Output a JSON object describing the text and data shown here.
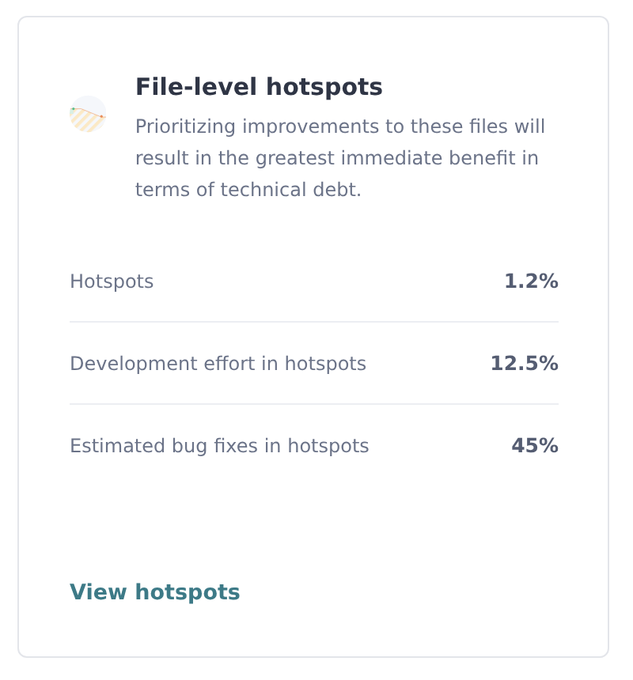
{
  "card": {
    "title": "File-level hotspots",
    "description": "Prioritizing improvements to these files will result in the greatest immediate benefit in terms of technical debt.",
    "metrics": [
      {
        "label": "Hotspots",
        "value": "1.2%"
      },
      {
        "label": "Development effort in hotspots",
        "value": "12.5%"
      },
      {
        "label": "Estimated bug fixes in hotspots",
        "value": "45%"
      }
    ],
    "link": "View hotspots"
  }
}
